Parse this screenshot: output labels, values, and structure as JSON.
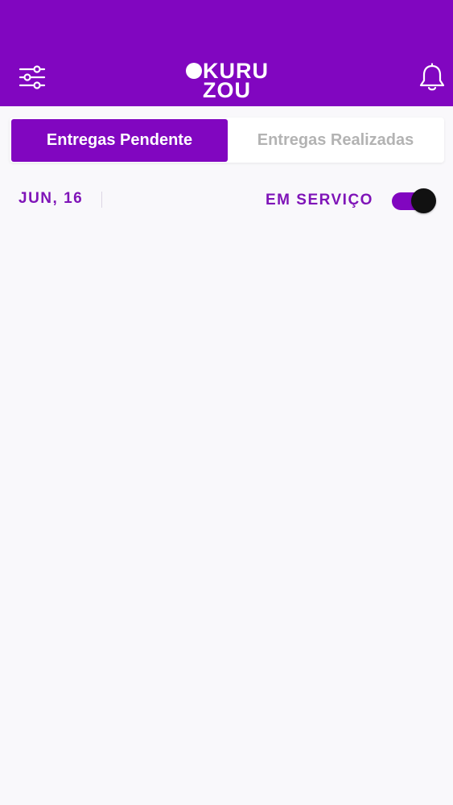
{
  "colors": {
    "brand": "#8106c0",
    "accent_text": "#7f14b8",
    "inactive_tab_text": "#b3b3b3",
    "background": "#f9f8fb",
    "toggle_knob": "#111111"
  },
  "header": {
    "logo": {
      "line1": "KURU",
      "line2": "ZOU"
    },
    "left_icon": "filter-sliders-icon",
    "right_icon": "bell-icon"
  },
  "tabs": [
    {
      "label": "Entregas Pendente",
      "active": true
    },
    {
      "label": "Entregas Realizadas",
      "active": false
    }
  ],
  "status_bar": {
    "date": "JUN, 16",
    "service_label": "EM SERVIÇO",
    "service_on": true
  }
}
